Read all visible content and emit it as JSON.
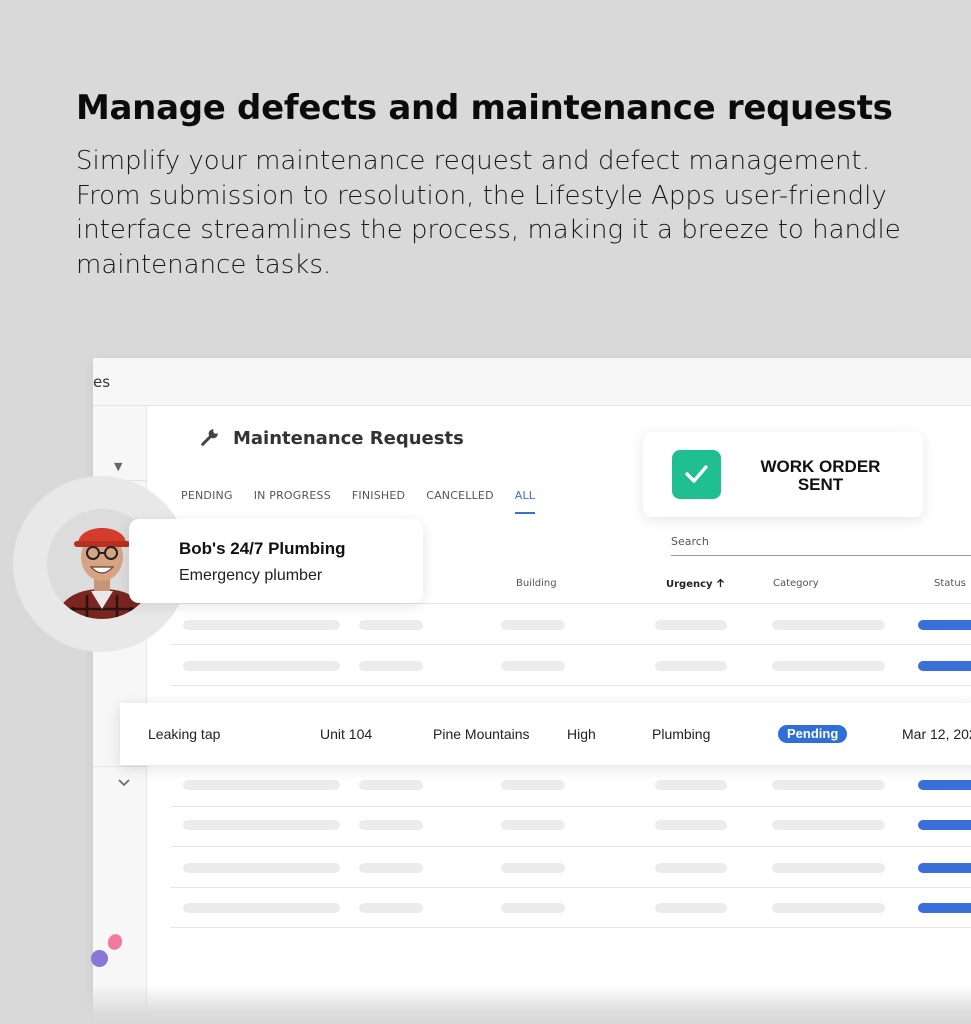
{
  "hero": {
    "headline": "Manage defects and maintenance requests",
    "subtext": "Simplify your maintenance request and defect management. From submission to resolution, the Lifestyle Apps user-friendly interface streamlines the process, making it a breeze to handle maintenance tasks."
  },
  "window": {
    "titlebar_text": "es",
    "page_title": "Maintenance Requests",
    "tabs": [
      "PENDING",
      "IN PROGRESS",
      "FINISHED",
      "CANCELLED",
      "ALL"
    ],
    "active_tab": "ALL",
    "search_label": "Search",
    "columns": {
      "building": "Building",
      "urgency": "Urgency",
      "urgency_sort_icon": "arrow-up-icon",
      "category": "Category",
      "status": "Status"
    }
  },
  "work_order": {
    "icon": "check-icon",
    "text": "WORK ORDER SENT",
    "accent": "#1fbf8f"
  },
  "contractor": {
    "name": "Bob's 24/7 Plumbing",
    "role": "Emergency plumber"
  },
  "highlight_row": {
    "title": "Leaking tap",
    "unit": "Unit 104",
    "building": "Pine Mountains",
    "urgency": "High",
    "category": "Plumbing",
    "status": "Pending",
    "date": "Mar 12, 202"
  },
  "colors": {
    "background": "#d9d9d9",
    "accent_blue": "#3b6fd8",
    "status_badge": "#2f6fd8"
  }
}
